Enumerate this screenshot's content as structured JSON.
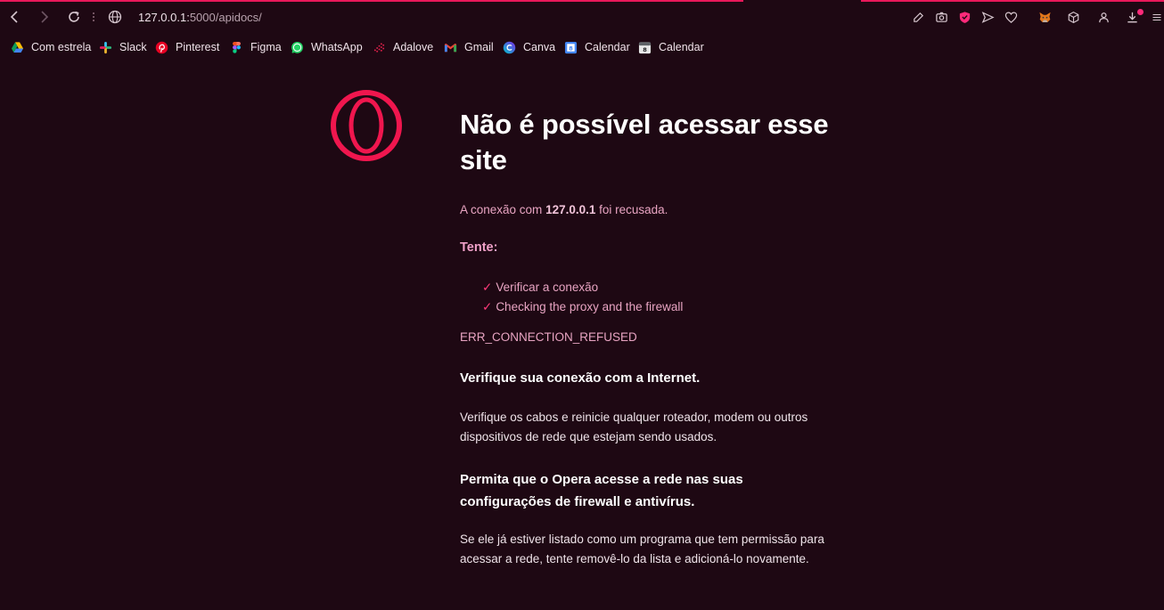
{
  "browser": {
    "url_host": "127.0.0.1:",
    "url_path": "5000/apidocs/",
    "accent_color": "#e8185a"
  },
  "toolbar": {
    "icons": [
      "back-icon",
      "forward-icon",
      "reload-icon",
      "site-info-icon",
      "edit-icon",
      "camera-icon",
      "shield-icon",
      "send-icon",
      "heart-icon",
      "metamask-icon",
      "cube-icon",
      "profile-icon",
      "download-icon",
      "menu-icon"
    ]
  },
  "bookmarks": [
    {
      "label": "Com estrela",
      "icon": "google-drive-icon"
    },
    {
      "label": "Slack",
      "icon": "slack-icon"
    },
    {
      "label": "Pinterest",
      "icon": "pinterest-icon"
    },
    {
      "label": "Figma",
      "icon": "figma-icon"
    },
    {
      "label": "WhatsApp",
      "icon": "whatsapp-icon"
    },
    {
      "label": "Adalove",
      "icon": "adalove-icon"
    },
    {
      "label": "Gmail",
      "icon": "gmail-icon"
    },
    {
      "label": "Canva",
      "icon": "canva-icon"
    },
    {
      "label": "Calendar",
      "icon": "google-calendar-icon"
    },
    {
      "label": "Calendar",
      "icon": "calendar-icon"
    }
  ],
  "error": {
    "title": "Não é possível acessar esse site",
    "connection_prefix": "A conexão com ",
    "connection_host": "127.0.0.1",
    "connection_suffix": " foi recusada.",
    "try_label": "Tente:",
    "suggestions": [
      "Verificar a conexão",
      "Checking the proxy and the firewall"
    ],
    "error_code": "ERR_CONNECTION_REFUSED",
    "section1_title": "Verifique sua conexão com a Internet.",
    "section1_body": "Verifique os cabos e reinicie qualquer roteador, modem ou outros dispositivos de rede que estejam sendo usados.",
    "section2_title": "Permita que o Opera acesse a rede nas suas configurações de firewall e antivírus.",
    "section2_body": "Se ele já estiver listado como um programa que tem permissão para acessar a rede, tente removê-lo da lista e adicioná-lo novamente."
  }
}
